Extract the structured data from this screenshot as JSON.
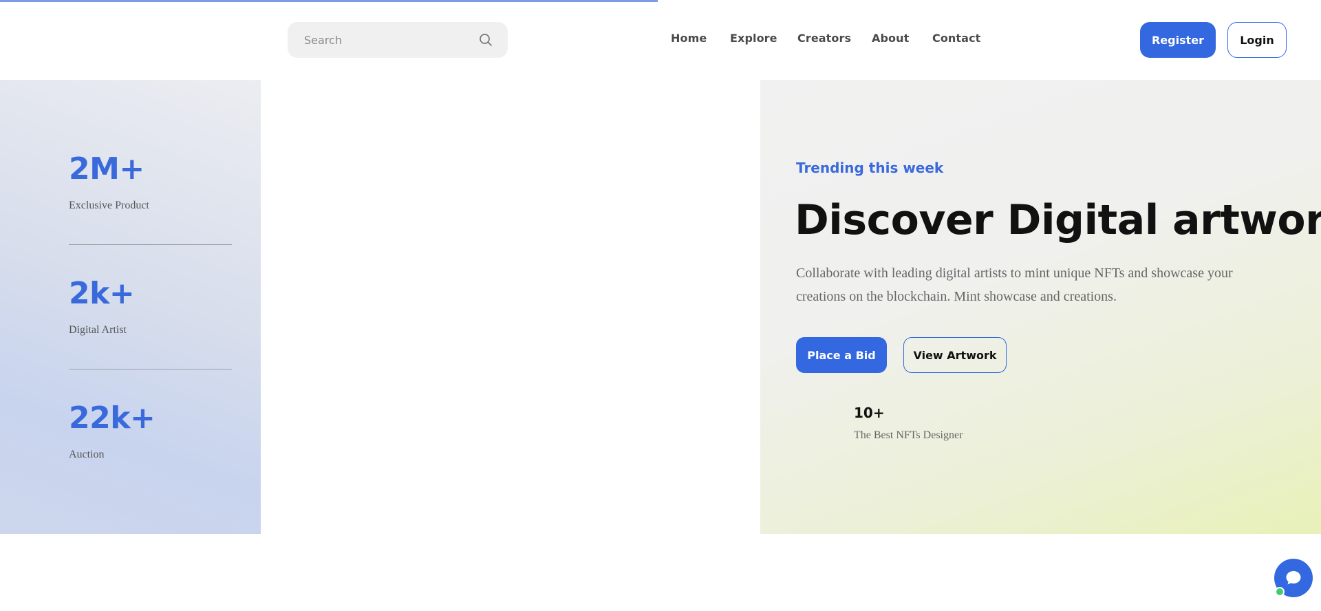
{
  "page": {
    "progress_percent": 49.8,
    "accent_color": "#3468e0"
  },
  "header": {
    "search": {
      "placeholder": "Search",
      "value": "",
      "icon": "search-icon"
    },
    "nav": [
      {
        "label": "Home"
      },
      {
        "label": "Explore"
      },
      {
        "label": "Creators"
      },
      {
        "label": "About"
      },
      {
        "label": "Contact"
      }
    ],
    "register_label": "Register",
    "login_label": "Login"
  },
  "stats": [
    {
      "value": "2M+",
      "label": "Exclusive Product"
    },
    {
      "value": "2k+",
      "label": "Digital Artist"
    },
    {
      "value": "22k+",
      "label": "Auction"
    }
  ],
  "hero": {
    "eyebrow": "Trending this week",
    "title": "Discover Digital artwork",
    "description": "Collaborate with leading digital artists to mint unique NFTs and showcase your creations on the blockchain. Mint showcase and creations.",
    "primary_button": "Place a Bid",
    "secondary_button": "View Artwork",
    "designer_count": "10+",
    "designer_label": "The Best NFTs Designer"
  },
  "chat": {
    "icon": "chat-bubble-icon",
    "status": "online"
  }
}
